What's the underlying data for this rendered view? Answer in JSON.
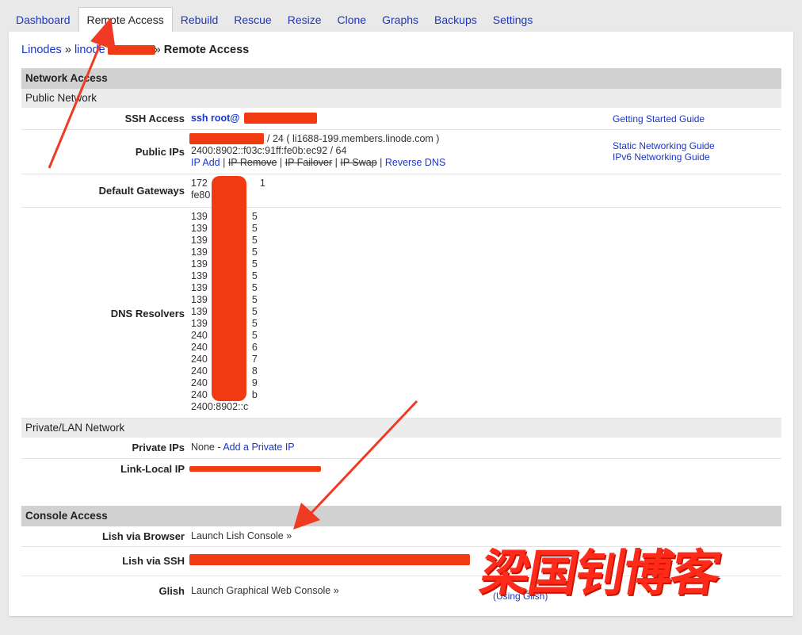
{
  "tabs": [
    {
      "label": "Dashboard",
      "active": false
    },
    {
      "label": "Remote Access",
      "active": true
    },
    {
      "label": "Rebuild",
      "active": false
    },
    {
      "label": "Rescue",
      "active": false
    },
    {
      "label": "Resize",
      "active": false
    },
    {
      "label": "Clone",
      "active": false
    },
    {
      "label": "Graphs",
      "active": false
    },
    {
      "label": "Backups",
      "active": false
    },
    {
      "label": "Settings",
      "active": false
    }
  ],
  "breadcrumb": {
    "root": "Linodes",
    "sep": "»",
    "node": "linode",
    "current": "Remote Access"
  },
  "network": {
    "title": "Network Access",
    "public_title": "Public Network",
    "ssh_label": "SSH Access",
    "ssh_value": "ssh root@",
    "getting_started": "Getting Started Guide",
    "public_ips_label": "Public IPs",
    "ipv4_suffix": "/ 24 ( li1688-199.members.linode.com )",
    "ipv6": "2400:8902::f03c:91ff:fe0b:ec92 / 64",
    "ip_add": "IP Add",
    "ip_remove": "IP Remove",
    "ip_failover": "IP Failover",
    "ip_swap": "IP Swap",
    "reverse_dns": "Reverse DNS",
    "static_guide": "Static Networking Guide",
    "ipv6_guide": "IPv6 Networking Guide",
    "gateways_label": "Default Gateways",
    "gateways": [
      "172",
      "fe80"
    ],
    "gateway_tail": "1",
    "dns_label": "DNS Resolvers",
    "dns": [
      {
        "head": "139",
        "tail": "5"
      },
      {
        "head": "139",
        "tail": "5"
      },
      {
        "head": "139",
        "tail": "5"
      },
      {
        "head": "139",
        "tail": "5"
      },
      {
        "head": "139",
        "tail": "5"
      },
      {
        "head": "139",
        "tail": "5"
      },
      {
        "head": "139",
        "tail": "5"
      },
      {
        "head": "139",
        "tail": "5"
      },
      {
        "head": "139",
        "tail": "5"
      },
      {
        "head": "139",
        "tail": "5"
      },
      {
        "head": "240",
        "tail": "5"
      },
      {
        "head": "240",
        "tail": "6"
      },
      {
        "head": "240",
        "tail": "7"
      },
      {
        "head": "240",
        "tail": "8"
      },
      {
        "head": "240",
        "tail": "9"
      },
      {
        "head": "240",
        "tail": "b"
      },
      {
        "head": "2400:8902::c",
        "tail": ""
      }
    ],
    "private_title": "Private/LAN Network",
    "private_label": "Private IPs",
    "private_none": "None - ",
    "add_private": "Add a Private IP",
    "linklocal_label": "Link-Local IP"
  },
  "console": {
    "title": "Console Access",
    "lish_browser_label": "Lish via Browser",
    "lish_browser_link": "Launch Lish Console »",
    "lish_ssh_label": "Lish via SSH",
    "glish_label": "Glish",
    "glish_link": "Launch Graphical Web Console »",
    "using_glish": "(Using Glish)"
  },
  "watermark": "梁国钊博客",
  "colors": {
    "redaction": "#f23a12",
    "arrow": "#f03a24",
    "link": "#1b36c4"
  }
}
